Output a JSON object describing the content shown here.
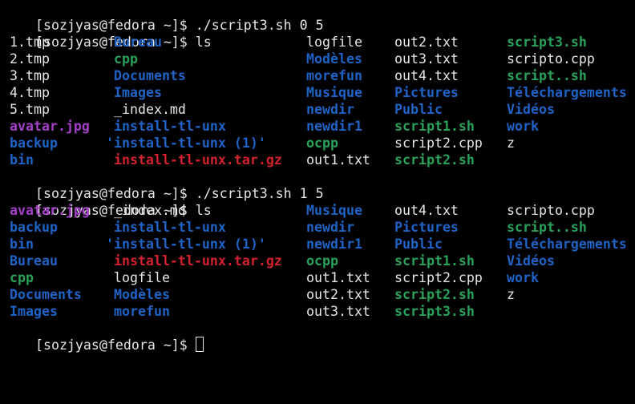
{
  "terminal": {
    "prompts": [
      {
        "prompt": "[sozjyas@fedora ~]$ ",
        "command": "./script3.sh 0 5"
      },
      {
        "prompt": "[sozjyas@fedora ~]$ ",
        "command": "ls"
      },
      {
        "prompt": "[sozjyas@fedora ~]$ ",
        "command": "./script3.sh 1 5"
      },
      {
        "prompt": "[sozjyas@fedora ~]$ ",
        "command": "ls"
      },
      {
        "prompt": "[sozjyas@fedora ~]$ ",
        "command": ""
      }
    ],
    "listing1": [
      [
        "1.tmp",
        "Bureau",
        "logfile",
        "out2.txt",
        "script3.sh"
      ],
      [
        "2.tmp",
        "cpp",
        "Modèles",
        "out3.txt",
        "scripto.cpp"
      ],
      [
        "3.tmp",
        "Documents",
        "morefun",
        "out4.txt",
        "script..sh"
      ],
      [
        "4.tmp",
        "Images",
        "Musique",
        "Pictures",
        "Téléchargements"
      ],
      [
        "5.tmp",
        "_index.md",
        "newdir",
        "Public",
        "Vidéos"
      ],
      [
        "avatar.jpg",
        "install-tl-unx",
        "newdir1",
        "script1.sh",
        "work"
      ],
      [
        "backup",
        "'install-tl-unx (1)'",
        "ocpp",
        "script2.cpp",
        "z"
      ],
      [
        "bin",
        "install-tl-unx.tar.gz",
        "out1.txt",
        "script2.sh",
        ""
      ]
    ],
    "listing2": [
      [
        "avatar.jpg",
        "_index.md",
        "Musique",
        "out4.txt",
        "scripto.cpp"
      ],
      [
        "backup",
        "install-tl-unx",
        "newdir",
        "Pictures",
        "script..sh"
      ],
      [
        "bin",
        "'install-tl-unx (1)'",
        "newdir1",
        "Public",
        "Téléchargements"
      ],
      [
        "Bureau",
        "install-tl-unx.tar.gz",
        "ocpp",
        "script1.sh",
        "Vidéos"
      ],
      [
        "cpp",
        "logfile",
        "out1.txt",
        "script2.cpp",
        "work"
      ],
      [
        "Documents",
        "Modèles",
        "out2.txt",
        "script2.sh",
        "z"
      ],
      [
        "Images",
        "morefun",
        "out3.txt",
        "script3.sh",
        ""
      ]
    ],
    "colors": {
      "background": "#000000",
      "plain": "#e6e6e6",
      "directory": "#1f63c6",
      "executable": "#2aa15a",
      "image": "#a43fc7",
      "archive": "#d3212d"
    }
  }
}
